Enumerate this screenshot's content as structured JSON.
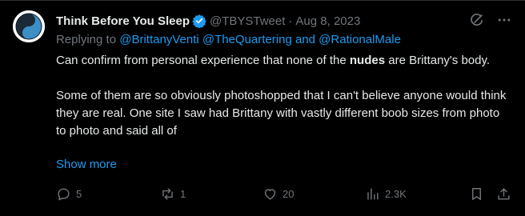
{
  "colors": {
    "background": "#000000",
    "text": "#e7e9ea",
    "muted": "#71767b",
    "link": "#1d9bf0",
    "verified": "#1d9bf0"
  },
  "tweet": {
    "display_name": "Think Before You Sleep",
    "handle": "@TBYSTweet",
    "separator": "·",
    "date": "Aug 8, 2023",
    "reply_prefix": "Replying to",
    "mentions": [
      "@BrittanyVenti",
      "@TheQuartering",
      "and",
      "@RationalMale"
    ],
    "paragraph1_before": "Can confirm from personal experience that none of the ",
    "paragraph1_bold": "nudes",
    "paragraph1_after": " are Brittany's body.",
    "paragraph2": "Some of them are so obviously photoshopped that I can't believe anyone would think they are real. One site I saw had Brittany with vastly different boob sizes from photo to photo and said all of",
    "show_more": "Show more"
  },
  "actions": {
    "replies": "5",
    "reposts": "1",
    "likes": "20",
    "views": "2.3K"
  },
  "icons": [
    "avatar-yin-yang",
    "verified-badge-icon",
    "grok-icon",
    "more-icon",
    "reply-icon",
    "repost-icon",
    "like-icon",
    "views-icon",
    "bookmark-icon",
    "share-icon"
  ]
}
